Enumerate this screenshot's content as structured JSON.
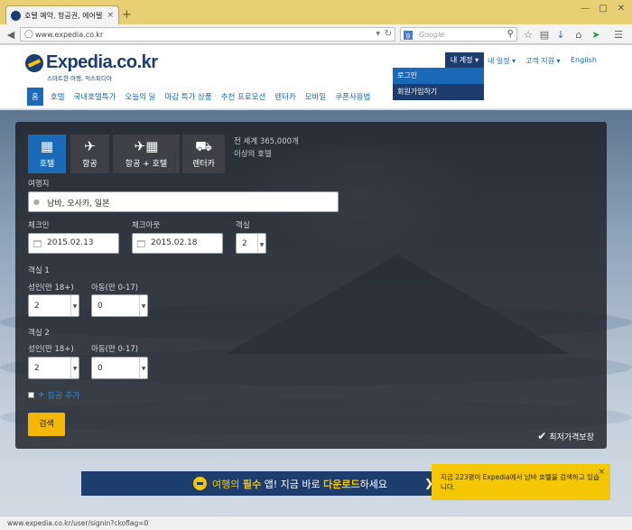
{
  "browser": {
    "tab_title": "호텔 예약, 항공권, 에어텔 ...",
    "tab_close": "×",
    "new_tab": "+",
    "url": "www.expedia.co.kr",
    "search_placeholder": "Google",
    "search_engine": "g",
    "status_url": "www.expedia.co.kr/user/signin?ckoflag=0"
  },
  "header": {
    "logo_text": "Expedia.co.kr",
    "logo_sub": "스마트한 여행, 익스피디아",
    "account_label": "내 계정 ▾",
    "links": [
      {
        "label": "내 일정 ▾"
      },
      {
        "label": "고객 지원 ▾"
      },
      {
        "label": "English"
      }
    ],
    "account_menu": [
      {
        "label": "로그인"
      },
      {
        "label": "회원가입하기"
      }
    ],
    "nav": [
      {
        "label": "홈"
      },
      {
        "label": "호텔"
      },
      {
        "label": "국내호텔특가"
      },
      {
        "label": "오늘의 딜"
      },
      {
        "label": "마감 특가 상품"
      },
      {
        "label": "추천 프로모션"
      },
      {
        "label": "렌터카"
      },
      {
        "label": "모바일"
      },
      {
        "label": "쿠폰사용법"
      }
    ]
  },
  "search": {
    "tabs": [
      {
        "label": "호텔",
        "icon": "hotel-icon"
      },
      {
        "label": "항공",
        "icon": "plane-icon"
      },
      {
        "label": "항공 + 호텔",
        "icon": "flight-hotel-icon"
      },
      {
        "label": "렌터카",
        "icon": "car-icon"
      }
    ],
    "tagline_1": "전 세계 365,000개",
    "tagline_2": "이상의 호텔",
    "destination_label": "여행지",
    "destination_value": "남바, 오사카, 일본",
    "checkin_label": "체크인",
    "checkin_value": "2015.02.13",
    "checkout_label": "체크아웃",
    "checkout_value": "2015.02.18",
    "rooms_label": "객실",
    "rooms_value": "2",
    "room1_label": "객실 1",
    "room2_label": "객실 2",
    "adults_label": "성인(만 18+)",
    "children_label": "아동(만 0-17)",
    "room1_adults": "2",
    "room1_children": "0",
    "room2_adults": "2",
    "room2_children": "0",
    "add_flight": "항공 추가",
    "search_button": "검색",
    "guarantee": "최저가격보장"
  },
  "banner": {
    "p1": "여행의",
    "p2": "필수",
    "p3": "앱! 지금 바로",
    "p4": "다운로드",
    "p5": "하세요"
  },
  "notice": {
    "text": "지금 223명이 Expedia에서 남바 호텔을 검색하고 있습니다.",
    "close": "×"
  },
  "colors": {
    "brand": "#1c3d6e",
    "accent": "#f5b800",
    "link": "#1a68b2"
  }
}
